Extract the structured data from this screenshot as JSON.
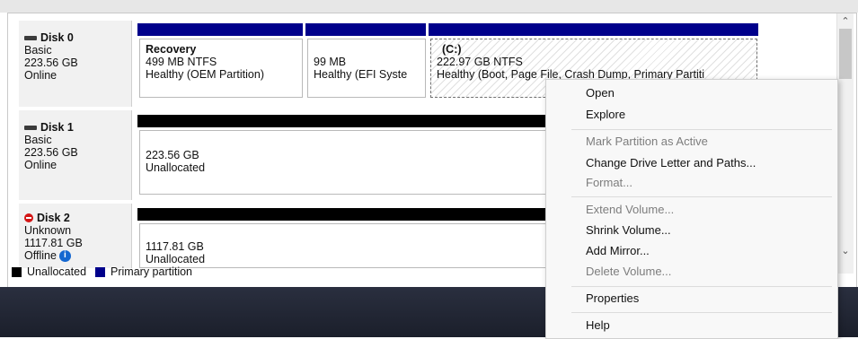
{
  "disks": [
    {
      "name": "Disk 0",
      "type": "Basic",
      "size": "223.56 GB",
      "status": "Online",
      "partitions": [
        {
          "title": "Recovery",
          "line2": "499 MB NTFS",
          "line3": "Healthy (OEM Partition)"
        },
        {
          "title": "",
          "line2": "99 MB",
          "line3": "Healthy (EFI Syste"
        },
        {
          "title": "(C:)",
          "line2": "222.97 GB NTFS",
          "line3": "Healthy (Boot, Page File, Crash Dump, Primary Partiti"
        }
      ]
    },
    {
      "name": "Disk 1",
      "type": "Basic",
      "size": "223.56 GB",
      "status": "Online",
      "partitions": [
        {
          "title": "",
          "line2": "223.56 GB",
          "line3": "Unallocated"
        }
      ]
    },
    {
      "name": "Disk 2",
      "type": "Unknown",
      "size": "1117.81 GB",
      "status": "Offline",
      "partitions": [
        {
          "title": "",
          "line2": "1117.81 GB",
          "line3": "Unallocated"
        }
      ]
    }
  ],
  "legend": {
    "unallocated": "Unallocated",
    "primary": "Primary partition"
  },
  "context_menu": {
    "open": "Open",
    "explore": "Explore",
    "mark_active": "Mark Partition as Active",
    "change_letter": "Change Drive Letter and Paths...",
    "format": "Format...",
    "extend": "Extend Volume...",
    "shrink": "Shrink Volume...",
    "add_mirror": "Add Mirror...",
    "delete": "Delete Volume...",
    "properties": "Properties",
    "help": "Help"
  },
  "icons": {
    "disk": "disk-icon",
    "offline_disk": "disk-offline-icon",
    "info": "info-icon"
  },
  "colors": {
    "primary_partition": "#00008b",
    "unallocated": "#000000",
    "menu_bg": "#f8f8f8"
  }
}
